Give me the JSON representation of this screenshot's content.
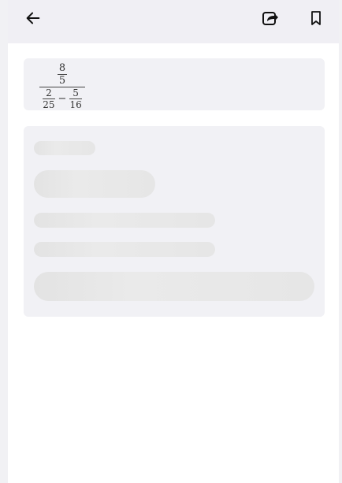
{
  "toolbar": {
    "back_icon": "arrow-left-icon",
    "share_icon": "share-icon",
    "bookmark_icon": "bookmark-icon"
  },
  "formula": {
    "outer_numerator": "8",
    "outer_denominator": "5",
    "left_fraction": {
      "numerator": "2",
      "denominator": "25"
    },
    "operator": "−",
    "right_fraction": {
      "numerator": "5",
      "denominator": "16"
    }
  },
  "colors": {
    "topbar_bg": "#f0eff4",
    "card_bg": "#f1f1f5",
    "skeleton": "#e4e4e4"
  }
}
